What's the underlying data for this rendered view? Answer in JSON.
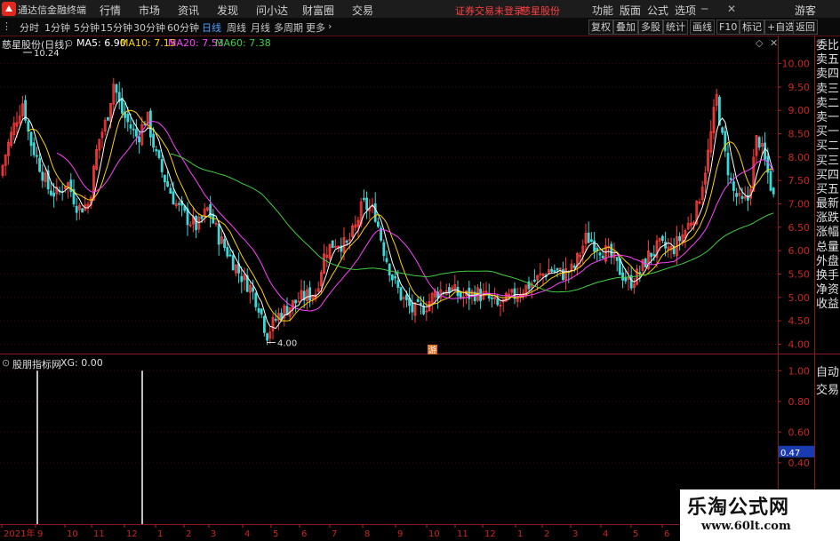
{
  "app": {
    "title": "通达信金融终端",
    "menu": [
      "行情",
      "市场",
      "资讯",
      "发现",
      "问小达",
      "财富圈",
      "交易"
    ],
    "notice": "证券交易未登录",
    "stock_name_top": "慈星股份",
    "right_menu": [
      "功能",
      "版面",
      "公式",
      "选项"
    ],
    "user": "游客",
    "colors": {
      "brand_red": "#e0281e",
      "notice_red": "#ff4040",
      "accent_blue": "#4aa0ff"
    }
  },
  "toolbar": {
    "periods": [
      "分时",
      "1分钟",
      "5分钟",
      "15分钟",
      "30分钟",
      "60分钟",
      "日线",
      "周线",
      "月线",
      "多周期",
      "更多"
    ],
    "active_period": "日线",
    "buttons": [
      "复权",
      "叠加",
      "多股",
      "统计",
      "画线",
      "F10",
      "标记",
      "+自选",
      "返回"
    ]
  },
  "main_chart": {
    "title": "慈星股份(日线)",
    "ma": [
      {
        "label": "MA5: 6.90",
        "color": "#ffffff"
      },
      {
        "label": "MA10: 7.15",
        "color": "#ffd200"
      },
      {
        "label": "MA20: 7.53",
        "color": "#ff40ff"
      },
      {
        "label": "MA60: 7.38",
        "color": "#40d040"
      }
    ],
    "y_ticks": [
      "10.00",
      "9.50",
      "9.00",
      "8.50",
      "8.00",
      "7.50",
      "7.00",
      "6.50",
      "6.00",
      "5.50",
      "5.00",
      "4.50",
      "4.00"
    ],
    "high_label": "10.24",
    "low_label": "4.00",
    "marker": "游"
  },
  "indicator": {
    "title": "股朋指标网",
    "value_label": "XG: 0.00",
    "y_ticks": [
      "1.00",
      "0.80",
      "0.60",
      "0.40"
    ],
    "current_value": "0.47"
  },
  "x_axis": [
    "2021年",
    "9",
    "10",
    "11",
    "12",
    "1",
    "2",
    "3",
    "4",
    "5",
    "6",
    "7",
    "8",
    "9",
    "10",
    "11",
    "12",
    "1",
    "2",
    "3",
    "4",
    "5",
    "6"
  ],
  "side_panel": {
    "items": [
      "委比",
      "卖五",
      "卖四",
      "卖三",
      "卖二",
      "卖一",
      "买一",
      "买二",
      "买三",
      "买四",
      "买五",
      "最新",
      "涨跌",
      "涨幅",
      "总量",
      "外盘",
      "换手",
      "净资",
      "收益"
    ],
    "lower": [
      "自动",
      "交易"
    ]
  },
  "watermark": {
    "title": "乐淘公式网",
    "url": "www.60lt.com"
  },
  "chart_data": {
    "type": "candlestick",
    "title": "慈星股份(日线)",
    "ylim": [
      3.8,
      10.6
    ],
    "x_months": [
      "2021年",
      "9",
      "10",
      "11",
      "12",
      "1",
      "2",
      "3",
      "4",
      "5",
      "6",
      "7",
      "8",
      "9",
      "10",
      "11",
      "12",
      "1",
      "2",
      "3",
      "4",
      "5",
      "6"
    ],
    "close_keypoints": [
      [
        0,
        7.6
      ],
      [
        8,
        8.2
      ],
      [
        18,
        8.8
      ],
      [
        26,
        9.2
      ],
      [
        33,
        8.4
      ],
      [
        45,
        7.8
      ],
      [
        55,
        7.3
      ],
      [
        65,
        7.2
      ],
      [
        75,
        7.5
      ],
      [
        88,
        6.9
      ],
      [
        100,
        7.0
      ],
      [
        110,
        8.3
      ],
      [
        120,
        8.8
      ],
      [
        128,
        9.6
      ],
      [
        136,
        9.0
      ],
      [
        145,
        8.7
      ],
      [
        155,
        8.4
      ],
      [
        165,
        8.9
      ],
      [
        176,
        8.0
      ],
      [
        186,
        7.5
      ],
      [
        198,
        7.0
      ],
      [
        210,
        6.7
      ],
      [
        222,
        6.5
      ],
      [
        234,
        6.9
      ],
      [
        246,
        6.3
      ],
      [
        258,
        5.9
      ],
      [
        270,
        5.5
      ],
      [
        282,
        5.2
      ],
      [
        292,
        4.8
      ],
      [
        300,
        4.2
      ],
      [
        312,
        4.6
      ],
      [
        325,
        4.8
      ],
      [
        340,
        5.0
      ],
      [
        355,
        5.1
      ],
      [
        366,
        6.0
      ],
      [
        378,
        6.2
      ],
      [
        390,
        6.1
      ],
      [
        400,
        6.5
      ],
      [
        408,
        7.0
      ],
      [
        422,
        6.8
      ],
      [
        432,
        6.0
      ],
      [
        442,
        5.4
      ],
      [
        452,
        5.0
      ],
      [
        465,
        4.7
      ],
      [
        478,
        4.8
      ],
      [
        490,
        5.1
      ],
      [
        505,
        5.2
      ],
      [
        520,
        5.0
      ],
      [
        535,
        5.1
      ],
      [
        548,
        5.0
      ],
      [
        560,
        4.8
      ],
      [
        575,
        5.0
      ],
      [
        590,
        5.2
      ],
      [
        605,
        5.4
      ],
      [
        618,
        5.6
      ],
      [
        632,
        5.5
      ],
      [
        645,
        5.6
      ],
      [
        660,
        6.3
      ],
      [
        672,
        6.1
      ],
      [
        686,
        5.9
      ],
      [
        700,
        5.5
      ],
      [
        708,
        5.3
      ],
      [
        718,
        5.5
      ],
      [
        730,
        5.9
      ],
      [
        742,
        6.1
      ],
      [
        756,
        6.0
      ],
      [
        770,
        6.4
      ],
      [
        784,
        6.9
      ],
      [
        796,
        8.0
      ],
      [
        806,
        9.3
      ],
      [
        814,
        8.2
      ],
      [
        824,
        7.3
      ],
      [
        834,
        7.0
      ],
      [
        842,
        7.1
      ],
      [
        852,
        8.5
      ],
      [
        862,
        7.8
      ],
      [
        872,
        7.0
      ]
    ],
    "xg_signals": [
      {
        "index": 1,
        "value": 1.0
      },
      {
        "index": 2,
        "value": 1.0
      }
    ],
    "indicator_current": 0.47
  }
}
